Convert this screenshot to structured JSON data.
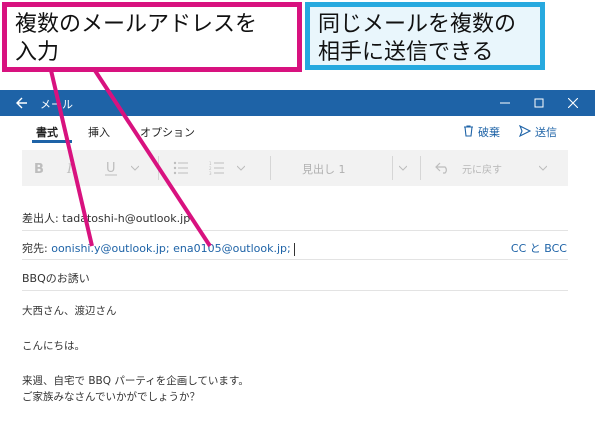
{
  "callouts": {
    "left_line1": "複数のメールアドレスを",
    "left_line2": "入力",
    "right_line1": "同じメールを複数の",
    "right_line2": "相手に送信できる"
  },
  "window": {
    "title": "メール",
    "accent": "#1e63a7"
  },
  "ribbon": {
    "tabs": [
      "書式",
      "挿入",
      "オプション"
    ],
    "discard_label": "破棄",
    "send_label": "送信"
  },
  "toolbar": {
    "heading_label": "見出し 1",
    "undo_label": "元に戻す"
  },
  "mail": {
    "from_label": "差出人:",
    "from_value": "tadatoshi-h@outlook.jp",
    "to_label": "宛先:",
    "to_value": "oonishi.y@outlook.jp; ena0105@outlook.jp;",
    "cc_bcc": "CC と BCC",
    "subject": "BBQのお誘い",
    "body": [
      "大西さん、渡辺さん",
      "こんにちは。",
      "来週、自宅で BBQ パーティを企画しています。",
      "ご家族みなさんでいかがでしょうか？"
    ]
  }
}
